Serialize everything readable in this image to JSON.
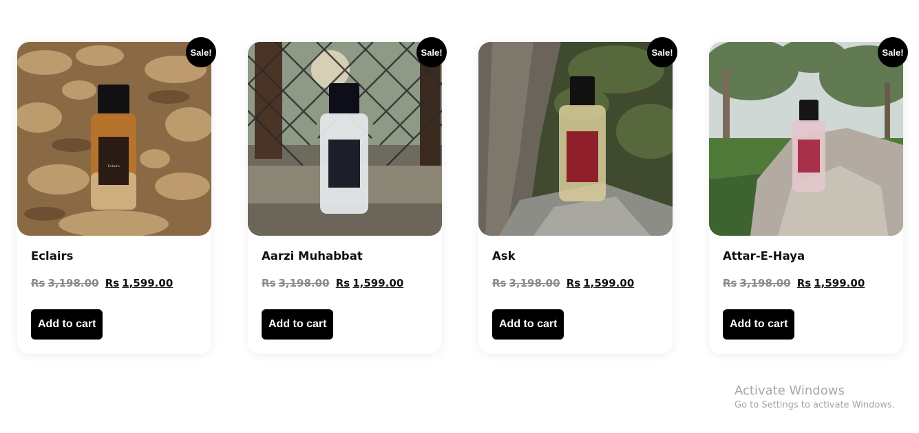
{
  "products": [
    {
      "name": "Eclairs",
      "badge": "Sale!",
      "currency": "Rs",
      "old_price": "3,198.00",
      "new_price": "1,599.00",
      "cta": "Add to cart",
      "accent": "#b8742a"
    },
    {
      "name": "Aarzi Muhabbat",
      "badge": "Sale!",
      "currency": "Rs",
      "old_price": "3,198.00",
      "new_price": "1,599.00",
      "cta": "Add to cart",
      "accent": "#1e1e2b"
    },
    {
      "name": "Ask",
      "badge": "Sale!",
      "currency": "Rs",
      "old_price": "3,198.00",
      "new_price": "1,599.00",
      "cta": "Add to cart",
      "accent": "#8f1f2a"
    },
    {
      "name": "Attar-E-Haya",
      "badge": "Sale!",
      "currency": "Rs",
      "old_price": "3,198.00",
      "new_price": "1,599.00",
      "cta": "Add to cart",
      "accent": "#a8304a"
    }
  ],
  "watermark": {
    "line1": "Activate Windows",
    "line2": "Go to Settings to activate Windows."
  }
}
